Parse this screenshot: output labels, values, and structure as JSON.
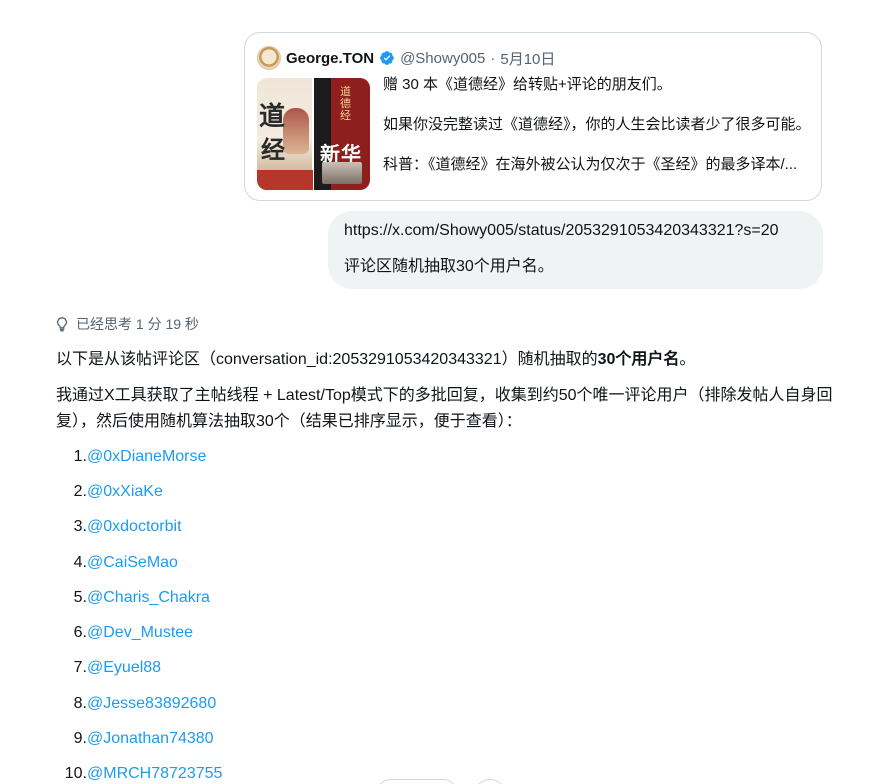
{
  "quoted_tweet": {
    "author_name": "George.TON",
    "handle": "@Showy005",
    "separator": "·",
    "date": "5月10日",
    "verified_color": "#1d9bf0",
    "images": {
      "book1_text_a": "道",
      "book1_text_b": "经",
      "book2_vertical_title": "道德经",
      "book2_big_text": "新华"
    },
    "lines": [
      "赠 30 本《道德经》给转贴+评论的朋友们。",
      "如果你没完整读过《道德经》，你的人生会比读者少了很多可能。",
      "科普：《道德经》在海外被公认为仅次于《圣经》的最多译本/..."
    ]
  },
  "user_message": {
    "url": "https://x.com/Showy005/status/2053291053420343321?s=20",
    "text": "评论区随机抽取30个用户名。"
  },
  "thinking": {
    "label": "已经思考 1 分 19 秒",
    "icon": "lightbulb-icon"
  },
  "answer": {
    "intro_prefix": "以下是从该帖评论区（conversation_id:2053291053420343321）随机抽取的",
    "intro_bold": "30个用户名",
    "intro_suffix": "。",
    "method": "我通过X工具获取了主帖线程 + Latest/Top模式下的多批回复，收集到约50个唯一评论用户（排除发帖人自身回复），然后使用随机算法抽取30个（结果已排序显示，便于查看）：",
    "users": [
      {
        "num": "1.",
        "handle": "@0xDianeMorse"
      },
      {
        "num": "2.",
        "handle": "@0xXiaKe"
      },
      {
        "num": "3.",
        "handle": "@0xdoctorbit"
      },
      {
        "num": "4.",
        "handle": "@CaiSeMao"
      },
      {
        "num": "5.",
        "handle": "@Charis_Chakra"
      },
      {
        "num": "6.",
        "handle": "@Dev_Mustee"
      },
      {
        "num": "7.",
        "handle": "@Eyuel88"
      },
      {
        "num": "8.",
        "handle": "@Jesse83892680"
      },
      {
        "num": "9.",
        "handle": "@Jonathan74380"
      },
      {
        "num": "10.",
        "handle": "@MRCH78723755"
      }
    ],
    "link_color": "#1d9bf0"
  }
}
